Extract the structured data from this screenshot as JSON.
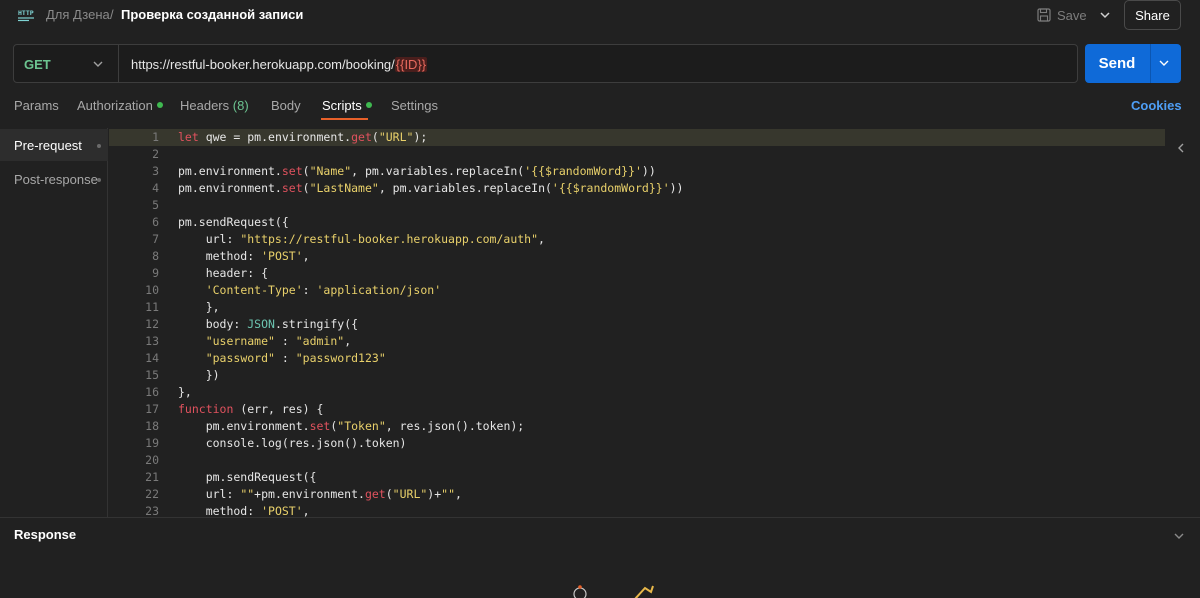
{
  "header": {
    "app_icon": "http-icon",
    "breadcrumb_parent": "Для Дзена",
    "breadcrumb_separator": "/",
    "title": "Проверка созданной записи",
    "save_label": "Save",
    "share_label": "Share"
  },
  "request": {
    "method": "GET",
    "url_base": "https://restful-booker.herokuapp.com/booking/",
    "url_variable": "{{ID}}",
    "send_label": "Send"
  },
  "tabs": {
    "params": "Params",
    "authorization": "Authorization",
    "headers": "Headers",
    "headers_count": "(8)",
    "body": "Body",
    "scripts": "Scripts",
    "settings": "Settings",
    "cookies": "Cookies",
    "active": "Scripts"
  },
  "script_nav": {
    "pre_request": "Pre-request",
    "post_response": "Post-response"
  },
  "editor": {
    "lines": [
      "let qwe = pm.environment.get(\"URL\");",
      "",
      "pm.environment.set(\"Name\", pm.variables.replaceIn('{{$randomWord}}'))",
      "pm.environment.set(\"LastName\", pm.variables.replaceIn('{{$randomWord}}'))",
      "",
      "pm.sendRequest({",
      "    url: \"https://restful-booker.herokuapp.com/auth\",",
      "    method: 'POST',",
      "    header: {",
      "    'Content-Type': 'application/json'",
      "    },",
      "    body: JSON.stringify({",
      "    \"username\" : \"admin\",",
      "    \"password\" : \"password123\"",
      "    })",
      "},",
      "function (err, res) {",
      "    pm.environment.set(\"Token\", res.json().token);",
      "    console.log(res.json().token)",
      "",
      "    pm.sendRequest({",
      "    url: \"\"+pm.environment.get(\"URL\")+\"\",",
      "    method: 'POST',"
    ]
  },
  "response": {
    "title": "Response"
  },
  "colors": {
    "keyword": "#e0525e",
    "string": "#e8d06a",
    "method_get": "#6cc490",
    "send_bg": "#0f6ad8",
    "tab_underline": "#e8612a",
    "cookies": "#4e9ef5",
    "dot": "#3fb950"
  }
}
